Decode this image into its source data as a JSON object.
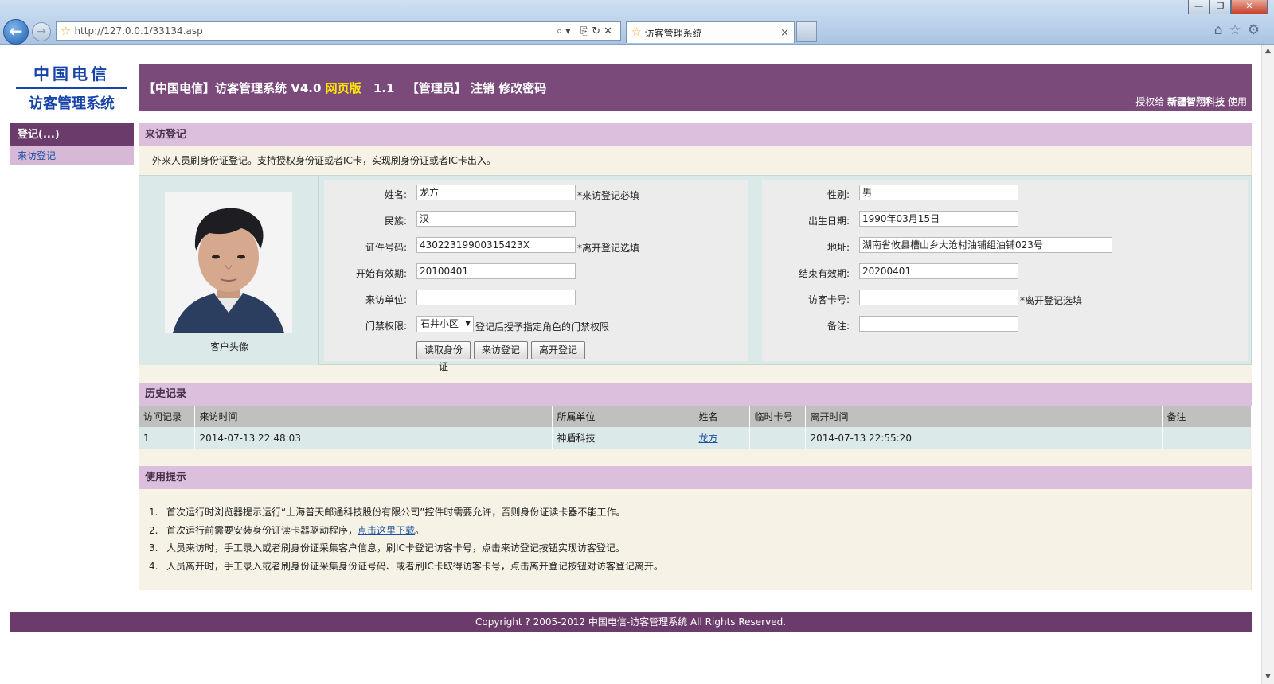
{
  "browser": {
    "url": "http://127.0.0.1/33134.asp",
    "tab_title": "访客管理系统",
    "tab_close": "×",
    "address_tools": "⌕▾ ⎘↻✕",
    "right_icons": "⌂☆⚙",
    "window_buttons": {
      "min": "—",
      "max": "❐",
      "close": "✕"
    },
    "back": "←",
    "forward": "→",
    "star_icon": "☆"
  },
  "logo": {
    "line1": "中国电信",
    "line2": "访客管理系统"
  },
  "header": {
    "part1": "【中国电信】访客管理系统",
    "version": "V4.0",
    "web": "网页版",
    "ver_num": "1.1",
    "role": "【管理员】",
    "logout": "注销",
    "change_pwd": "修改密码",
    "license_pre": "授权给",
    "license_name": "新疆智翔科技",
    "license_post": "使用"
  },
  "sidebar": {
    "section": "登记(...)",
    "items": [
      {
        "label": "来访登记"
      }
    ]
  },
  "register": {
    "heading": "来访登记",
    "note": "外来人员刷身份证登记。支持授权身份证或者IC卡，实现刷身份证或者IC卡出入。",
    "photo_caption": "客户头像",
    "left": {
      "name_label": "姓名:",
      "name_value": "龙方",
      "name_hint": "*来访登记必填",
      "ethnic_label": "民族:",
      "ethnic_value": "汉",
      "id_label": "证件号码:",
      "id_value": "43022319900315423X",
      "id_hint": "*离开登记选填",
      "start_label": "开始有效期:",
      "start_value": "20100401",
      "unit_label": "来访单位:",
      "unit_value": "",
      "access_label": "门禁权限:",
      "access_value": "石井小区",
      "access_arrow": "▼",
      "access_hint": "登记后授予指定角色的门禁权限",
      "btn_read": "读取身份证",
      "btn_visit": "来访登记",
      "btn_leave": "离开登记"
    },
    "right": {
      "gender_label": "性别:",
      "gender_value": "男",
      "birth_label": "出生日期:",
      "birth_value": "1990年03月15日",
      "addr_label": "地址:",
      "addr_value": "湖南省攸县槽山乡大沧村油铺组油铺023号",
      "end_label": "结束有效期:",
      "end_value": "20200401",
      "card_label": "访客卡号:",
      "card_value": "",
      "card_hint": "*离开登记选填",
      "remark_label": "备注:",
      "remark_value": ""
    }
  },
  "history": {
    "heading": "历史记录",
    "columns": [
      "访问记录",
      "来访时间",
      "所属单位",
      "姓名",
      "临时卡号",
      "离开时间",
      "备注"
    ],
    "rows": [
      {
        "no": "1",
        "arrive": "2014-07-13 22:48:03",
        "unit": "神盾科技",
        "name": "龙方",
        "card": "",
        "leave": "2014-07-13 22:55:20",
        "remark": ""
      }
    ]
  },
  "tips": {
    "heading": "使用提示",
    "items": [
      {
        "n": "1.",
        "text": "首次运行时浏览器提示运行“上海普天邮通科技股份有限公司”控件时需要允许，否则身份证读卡器不能工作。"
      },
      {
        "n": "2.",
        "pre": "首次运行前需要安装身份证读卡器驱动程序，",
        "link": "点击这里下载",
        "post": "。"
      },
      {
        "n": "3.",
        "text": "人员来访时，手工录入或者刷身份证采集客户信息，刷IC卡登记访客卡号，点击来访登记按钮实现访客登记。"
      },
      {
        "n": "4.",
        "text": "人员离开时，手工录入或者刷身份证采集身份证号码、或者刷IC卡取得访客卡号，点击离开登记按钮对访客登记离开。"
      }
    ]
  },
  "footer": {
    "text": "Copyright ? 2005-2012  中国电信-访客管理系统   All Rights Reserved."
  },
  "scrollbar": {
    "up": "▲",
    "down": "▼"
  }
}
